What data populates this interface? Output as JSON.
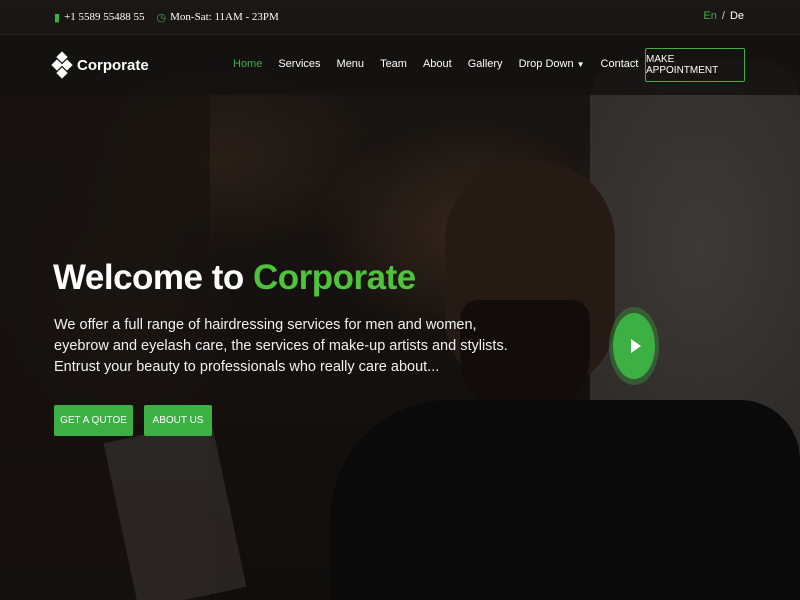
{
  "topbar": {
    "phone": "+1 5589 55488 55",
    "hours": "Mon-Sat: 11AM - 23PM",
    "phone_icon": "phone-icon",
    "clock_icon": "clock-icon"
  },
  "language": {
    "active": "En",
    "separator": "/",
    "other": "De"
  },
  "brand": {
    "name": "Corporate",
    "icon": "diamond-logo-icon"
  },
  "nav": {
    "items": [
      {
        "label": "Home",
        "active": true
      },
      {
        "label": "Services"
      },
      {
        "label": "Menu"
      },
      {
        "label": "Team"
      },
      {
        "label": "About"
      },
      {
        "label": "Gallery"
      },
      {
        "label": "Drop Down"
      },
      {
        "label": "Contact"
      }
    ],
    "cta": "MAKE APPOINTMENT"
  },
  "hero": {
    "title_prefix": "Welcome to",
    "title_accent": "Corporate",
    "description": "We offer a full range of hairdressing services for men and women, eyebrow and eyelash care, the services of make-up artists and stylists. Entrust your beauty to professionals who really care about...",
    "btn_quote": "GET A QUTOE",
    "btn_about": "ABOUT US",
    "play_icon": "play-icon"
  },
  "colors": {
    "accent": "#3cb043",
    "background": "#1b1714"
  }
}
